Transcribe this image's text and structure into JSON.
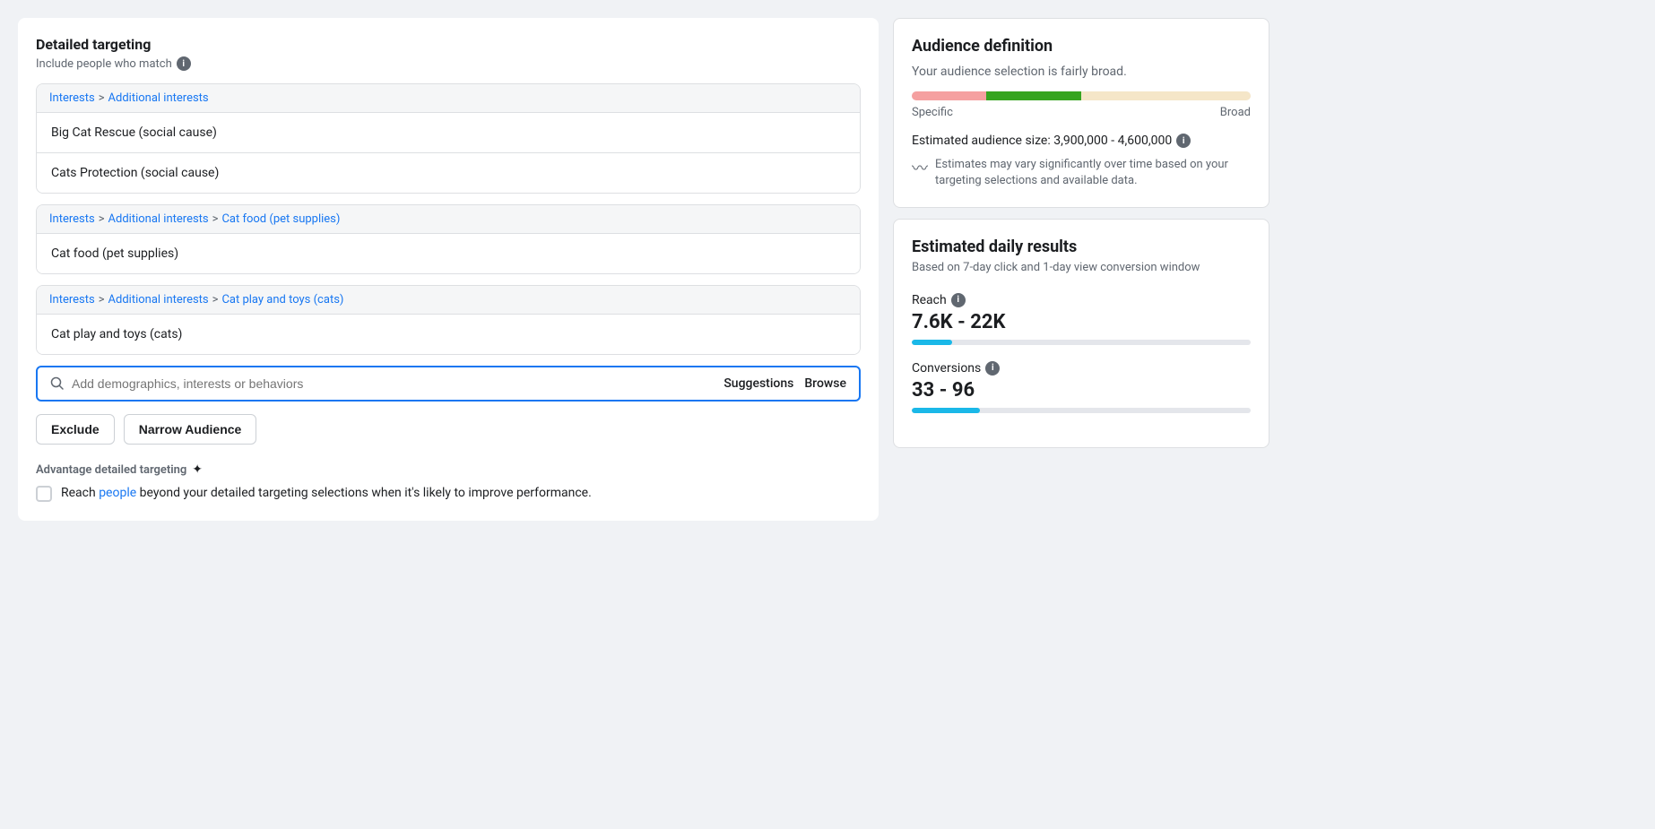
{
  "left": {
    "section_title": "Detailed targeting",
    "section_subtitle": "Include people who match",
    "groups": [
      {
        "breadcrumbs": [
          {
            "text": "Interests",
            "link": true
          },
          {
            "text": ">",
            "sep": true
          },
          {
            "text": "Additional interests",
            "link": true
          }
        ],
        "items": [
          {
            "label": "Big Cat Rescue (social cause)"
          },
          {
            "label": "Cats Protection (social cause)"
          }
        ]
      },
      {
        "breadcrumbs": [
          {
            "text": "Interests",
            "link": true
          },
          {
            "text": ">",
            "sep": true
          },
          {
            "text": "Additional interests",
            "link": true
          },
          {
            "text": ">",
            "sep": true
          },
          {
            "text": "Cat food (pet supplies)",
            "link": true
          }
        ],
        "items": [
          {
            "label": "Cat food (pet supplies)"
          }
        ]
      },
      {
        "breadcrumbs": [
          {
            "text": "Interests",
            "link": true
          },
          {
            "text": ">",
            "sep": true
          },
          {
            "text": "Additional interests",
            "link": true
          },
          {
            "text": ">",
            "sep": true
          },
          {
            "text": "Cat play and toys (cats)",
            "link": true
          }
        ],
        "items": [
          {
            "label": "Cat play and toys (cats)"
          }
        ]
      }
    ],
    "search": {
      "placeholder": "Add demographics, interests or behaviors",
      "suggestions_label": "Suggestions",
      "browse_label": "Browse"
    },
    "buttons": {
      "exclude_label": "Exclude",
      "narrow_label": "Narrow Audience"
    },
    "advantage": {
      "title": "Advantage detailed targeting",
      "checkbox_text_before": "Reach ",
      "checkbox_link_text": "people",
      "checkbox_text_after": " beyond your detailed targeting selections when it's likely to improve performance."
    }
  },
  "right": {
    "audience_card": {
      "title": "Audience definition",
      "subtitle": "Your audience selection is fairly broad.",
      "meter": {
        "specific_label": "Specific",
        "broad_label": "Broad"
      },
      "audience_size_label": "Estimated audience size: 3,900,000 - 4,600,000",
      "estimates_note": "Estimates may vary significantly over time based on your targeting selections and available data."
    },
    "results_card": {
      "title": "Estimated daily results",
      "subtitle": "Based on 7-day click and 1-day view conversion window",
      "reach": {
        "label": "Reach",
        "value": "7.6K - 22K"
      },
      "conversions": {
        "label": "Conversions",
        "value": "33 - 96"
      }
    }
  }
}
